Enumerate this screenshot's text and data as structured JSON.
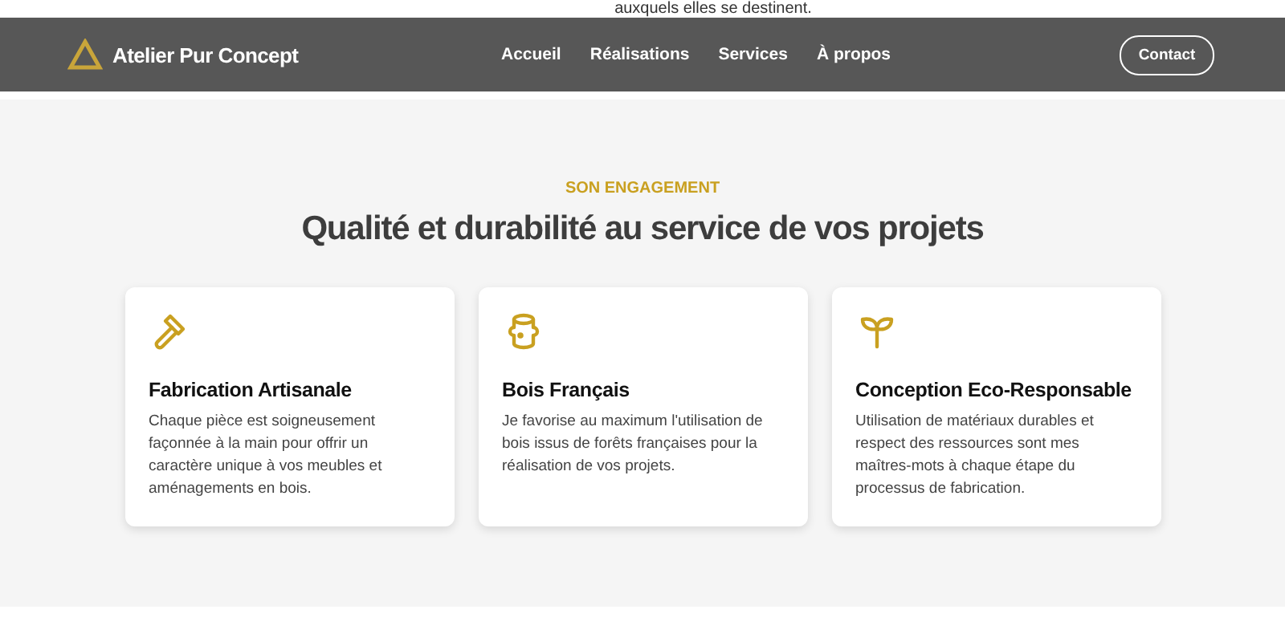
{
  "top_text": "auxquels elles se destinent.",
  "header": {
    "brand": "Atelier Pur Concept",
    "nav": [
      "Accueil",
      "Réalisations",
      "Services",
      "À propos"
    ],
    "contact_button": "Contact"
  },
  "section": {
    "eyebrow": "SON ENGAGEMENT",
    "title": "Qualité et durabilité au service de vos projets",
    "cards": [
      {
        "kind": "hammer",
        "title": "Fabrication Artisanale",
        "text": "Chaque pièce est soigneusement façonnée à la main pour offrir un caractère unique à vos meubles et aménagements en bois."
      },
      {
        "kind": "log",
        "title": "Bois Français",
        "text": "Je favorise au maximum l'utilisation de bois issus de forêts françaises pour la réalisation de vos projets."
      },
      {
        "kind": "sprout",
        "title": "Conception Eco-Responsable",
        "text": "Utilisation de matériaux durables et respect des ressources sont mes maîtres-mots à chaque étape du processus de fabrication."
      }
    ]
  }
}
